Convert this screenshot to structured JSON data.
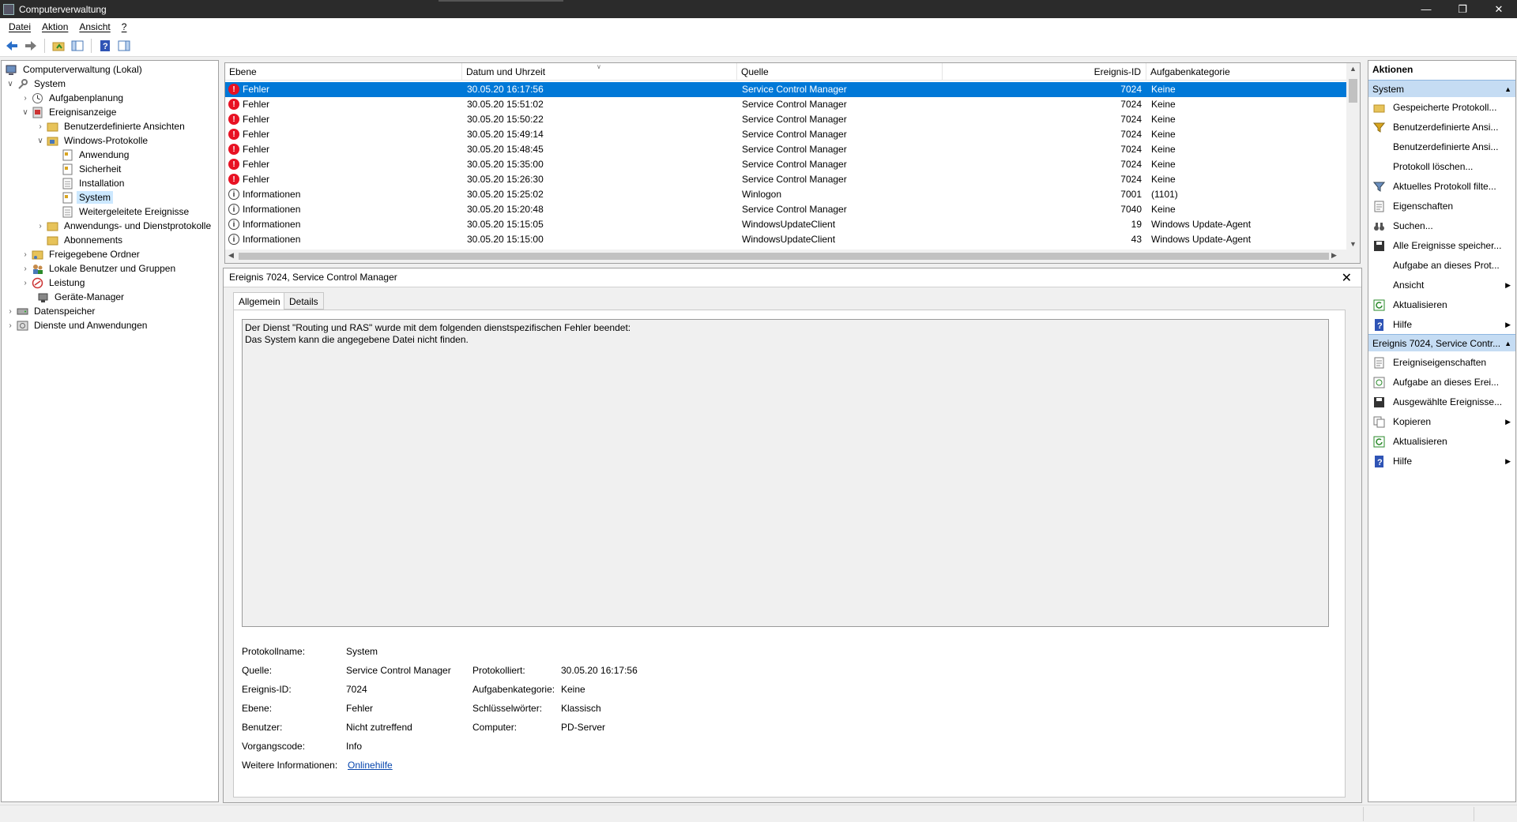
{
  "window": {
    "title": "Computerverwaltung"
  },
  "menu": {
    "items": [
      "Datei",
      "Aktion",
      "Ansicht",
      "?"
    ]
  },
  "tree": {
    "nodes": [
      {
        "label": "Computerverwaltung (Lokal)",
        "icon": "computer-management-icon"
      },
      {
        "label": "System",
        "icon": "system-tools-icon"
      },
      {
        "label": "Aufgabenplanung",
        "icon": "clock-icon"
      },
      {
        "label": "Ereignisanzeige",
        "icon": "event-viewer-icon"
      },
      {
        "label": "Benutzerdefinierte Ansichten",
        "icon": "folder-icon"
      },
      {
        "label": "Windows-Protokolle",
        "icon": "folder-icon"
      },
      {
        "label": "Anwendung",
        "icon": "log-icon"
      },
      {
        "label": "Sicherheit",
        "icon": "log-icon"
      },
      {
        "label": "Installation",
        "icon": "log-icon"
      },
      {
        "label": "System",
        "icon": "log-icon"
      },
      {
        "label": "Weitergeleitete Ereignisse",
        "icon": "log-icon"
      },
      {
        "label": "Anwendungs- und Dienstprotokolle",
        "icon": "folder-icon"
      },
      {
        "label": "Abonnements",
        "icon": "subscriptions-icon"
      },
      {
        "label": "Freigegebene Ordner",
        "icon": "shared-folder-icon"
      },
      {
        "label": "Lokale Benutzer und Gruppen",
        "icon": "users-icon"
      },
      {
        "label": "Leistung",
        "icon": "performance-icon"
      },
      {
        "label": "Geräte-Manager",
        "icon": "device-manager-icon"
      },
      {
        "label": "Datenspeicher",
        "icon": "storage-icon"
      },
      {
        "label": "Dienste und Anwendungen",
        "icon": "services-icon"
      }
    ]
  },
  "events": {
    "columns": [
      "Ebene",
      "Datum und Uhrzeit",
      "Quelle",
      "Ereignis-ID",
      "Aufgabenkategorie"
    ],
    "rows": [
      {
        "level": "Fehler",
        "type": "error",
        "date": "30.05.20 16:17:56",
        "source": "Service Control Manager",
        "id": "7024",
        "category": "Keine"
      },
      {
        "level": "Fehler",
        "type": "error",
        "date": "30.05.20 15:51:02",
        "source": "Service Control Manager",
        "id": "7024",
        "category": "Keine"
      },
      {
        "level": "Fehler",
        "type": "error",
        "date": "30.05.20 15:50:22",
        "source": "Service Control Manager",
        "id": "7024",
        "category": "Keine"
      },
      {
        "level": "Fehler",
        "type": "error",
        "date": "30.05.20 15:49:14",
        "source": "Service Control Manager",
        "id": "7024",
        "category": "Keine"
      },
      {
        "level": "Fehler",
        "type": "error",
        "date": "30.05.20 15:48:45",
        "source": "Service Control Manager",
        "id": "7024",
        "category": "Keine"
      },
      {
        "level": "Fehler",
        "type": "error",
        "date": "30.05.20 15:35:00",
        "source": "Service Control Manager",
        "id": "7024",
        "category": "Keine"
      },
      {
        "level": "Fehler",
        "type": "error",
        "date": "30.05.20 15:26:30",
        "source": "Service Control Manager",
        "id": "7024",
        "category": "Keine"
      },
      {
        "level": "Informationen",
        "type": "info",
        "date": "30.05.20 15:25:02",
        "source": "Winlogon",
        "id": "7001",
        "category": "(1101)"
      },
      {
        "level": "Informationen",
        "type": "info",
        "date": "30.05.20 15:20:48",
        "source": "Service Control Manager",
        "id": "7040",
        "category": "Keine"
      },
      {
        "level": "Informationen",
        "type": "info",
        "date": "30.05.20 15:15:05",
        "source": "WindowsUpdateClient",
        "id": "19",
        "category": "Windows Update-Agent"
      },
      {
        "level": "Informationen",
        "type": "info",
        "date": "30.05.20 15:15:00",
        "source": "WindowsUpdateClient",
        "id": "43",
        "category": "Windows Update-Agent"
      }
    ]
  },
  "detail": {
    "title": "Ereignis 7024, Service Control Manager",
    "tabs": [
      "Allgemein",
      "Details"
    ],
    "message_line1": "Der Dienst \"Routing und RAS\" wurde mit dem folgenden dienstspezifischen Fehler beendet:",
    "message_line2": "Das System kann die angegebene Datei nicht finden.",
    "labels": {
      "logname": "Protokollname:",
      "source": "Quelle:",
      "eventid": "Ereignis-ID:",
      "level": "Ebene:",
      "user": "Benutzer:",
      "opcode": "Vorgangscode:",
      "moreinfo": "Weitere Informationen:",
      "logged": "Protokolliert:",
      "taskcat": "Aufgabenkategorie:",
      "keywords": "Schlüsselwörter:",
      "computer": "Computer:"
    },
    "values": {
      "logname": "System",
      "source": "Service Control Manager",
      "eventid": "7024",
      "level": "Fehler",
      "user": "Nicht zutreffend",
      "opcode": "Info",
      "moreinfo": "Onlinehilfe",
      "logged": "30.05.20 16:17:56",
      "taskcat": "Keine",
      "keywords": "Klassisch",
      "computer": "PD-Server"
    }
  },
  "actions": {
    "title": "Aktionen",
    "group1": "System",
    "items1": [
      {
        "label": "Gespeicherte Protokoll...",
        "icon": "open-folder-icon"
      },
      {
        "label": "Benutzerdefinierte Ansi...",
        "icon": "filter-icon"
      },
      {
        "label": "Benutzerdefinierte Ansi...",
        "icon": ""
      },
      {
        "label": "Protokoll löschen...",
        "icon": ""
      },
      {
        "label": "Aktuelles Protokoll filte...",
        "icon": "funnel-icon"
      },
      {
        "label": "Eigenschaften",
        "icon": "properties-icon"
      },
      {
        "label": "Suchen...",
        "icon": "binoculars-icon"
      },
      {
        "label": "Alle Ereignisse speicher...",
        "icon": "save-icon"
      },
      {
        "label": "Aufgabe an dieses Prot...",
        "icon": ""
      },
      {
        "label": "Ansicht",
        "icon": "",
        "submenu": true
      },
      {
        "label": "Aktualisieren",
        "icon": "refresh-icon"
      },
      {
        "label": "Hilfe",
        "icon": "help-icon",
        "submenu": true
      }
    ],
    "group2": "Ereignis 7024, Service Contr...",
    "items2": [
      {
        "label": "Ereigniseigenschaften",
        "icon": "properties-icon"
      },
      {
        "label": "Aufgabe an dieses Erei...",
        "icon": "task-icon"
      },
      {
        "label": "Ausgewählte Ereignisse...",
        "icon": "save-icon"
      },
      {
        "label": "Kopieren",
        "icon": "copy-icon",
        "submenu": true
      },
      {
        "label": "Aktualisieren",
        "icon": "refresh-icon"
      },
      {
        "label": "Hilfe",
        "icon": "help-icon",
        "submenu": true
      }
    ]
  },
  "colors": {
    "selection": "#0078d7",
    "error": "#e81123",
    "group": "#c5dcf3"
  }
}
